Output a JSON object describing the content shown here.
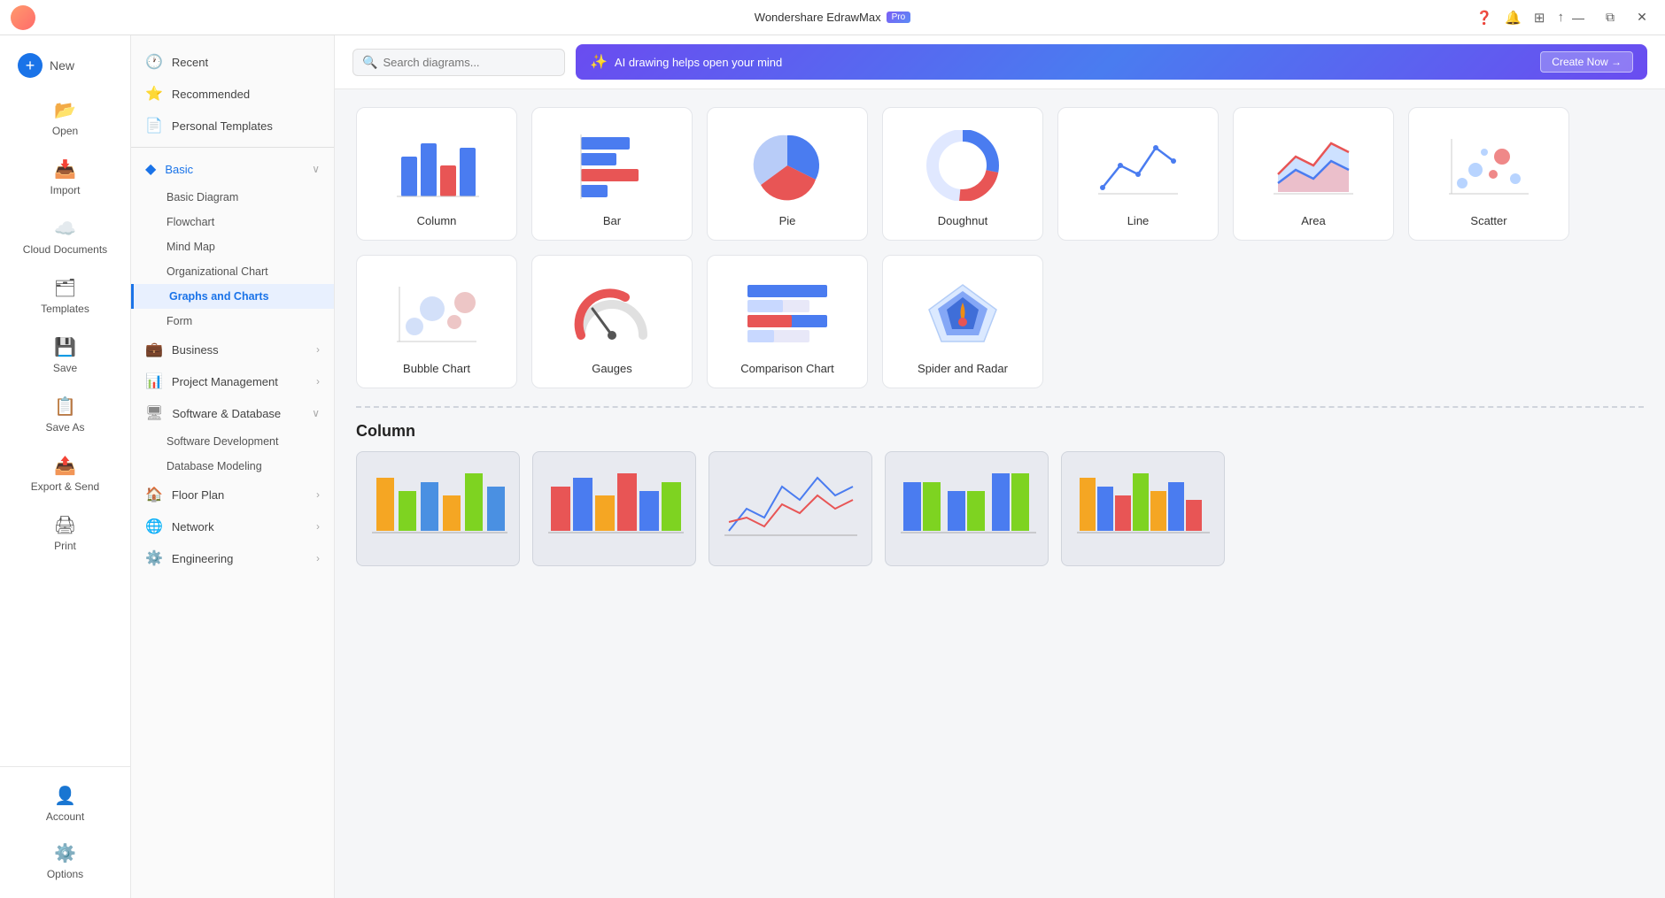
{
  "titlebar": {
    "title": "Wondershare EdrawMax",
    "pro_label": "Pro",
    "controls": [
      "minimize",
      "restore",
      "close"
    ]
  },
  "sidebar_narrow": {
    "items": [
      {
        "id": "new",
        "label": "New",
        "icon": "➕"
      },
      {
        "id": "open",
        "label": "Open",
        "icon": "📂"
      },
      {
        "id": "import",
        "label": "Import",
        "icon": "📥"
      },
      {
        "id": "cloud",
        "label": "Cloud Documents",
        "icon": "☁️"
      },
      {
        "id": "templates",
        "label": "Templates",
        "icon": "🗂"
      },
      {
        "id": "save",
        "label": "Save",
        "icon": "💾"
      },
      {
        "id": "save-as",
        "label": "Save As",
        "icon": "📋"
      },
      {
        "id": "export",
        "label": "Export & Send",
        "icon": "📤"
      },
      {
        "id": "print",
        "label": "Print",
        "icon": "🖨"
      }
    ],
    "bottom_items": [
      {
        "id": "account",
        "label": "Account",
        "icon": "👤"
      },
      {
        "id": "options",
        "label": "Options",
        "icon": "⚙️"
      }
    ]
  },
  "sidebar_wide": {
    "sections": [
      {
        "id": "recent",
        "label": "Recent",
        "icon": "🕐",
        "expandable": false
      },
      {
        "id": "recommended",
        "label": "Recommended",
        "icon": "⭐",
        "expandable": false
      },
      {
        "id": "personal-templates",
        "label": "Personal Templates",
        "icon": "📄",
        "expandable": false
      }
    ],
    "categories": [
      {
        "id": "basic",
        "label": "Basic",
        "icon": "◆",
        "expanded": true,
        "subitems": [
          "Basic Diagram",
          "Flowchart",
          "Mind Map",
          "Organizational Chart",
          "Graphs and Charts",
          "Form"
        ]
      },
      {
        "id": "business",
        "label": "Business",
        "icon": "💼",
        "expanded": false,
        "subitems": []
      },
      {
        "id": "project",
        "label": "Project Management",
        "icon": "📊",
        "expanded": false,
        "subitems": []
      },
      {
        "id": "software",
        "label": "Software & Database",
        "icon": "🖥",
        "expanded": true,
        "subitems": [
          "Software Development",
          "Database Modeling"
        ]
      },
      {
        "id": "floor",
        "label": "Floor Plan",
        "icon": "🏠",
        "expanded": false,
        "subitems": []
      },
      {
        "id": "network",
        "label": "Network",
        "icon": "🌐",
        "expanded": false,
        "subitems": []
      },
      {
        "id": "engineering",
        "label": "Engineering",
        "icon": "⚙️",
        "expanded": false,
        "subitems": []
      }
    ],
    "active_subitem": "Graphs and Charts"
  },
  "header": {
    "search_placeholder": "Search diagrams...",
    "ai_text": "AI drawing helps open your mind",
    "ai_create": "Create Now →"
  },
  "charts": {
    "items": [
      {
        "id": "column",
        "label": "Column"
      },
      {
        "id": "bar",
        "label": "Bar"
      },
      {
        "id": "pie",
        "label": "Pie"
      },
      {
        "id": "doughnut",
        "label": "Doughnut"
      },
      {
        "id": "line",
        "label": "Line"
      },
      {
        "id": "area",
        "label": "Area"
      },
      {
        "id": "scatter",
        "label": "Scatter"
      },
      {
        "id": "bubble",
        "label": "Bubble Chart"
      },
      {
        "id": "gauges",
        "label": "Gauges"
      },
      {
        "id": "comparison",
        "label": "Comparison Chart"
      },
      {
        "id": "spider",
        "label": "Spider and Radar"
      }
    ]
  },
  "templates_section": {
    "title": "Column"
  }
}
